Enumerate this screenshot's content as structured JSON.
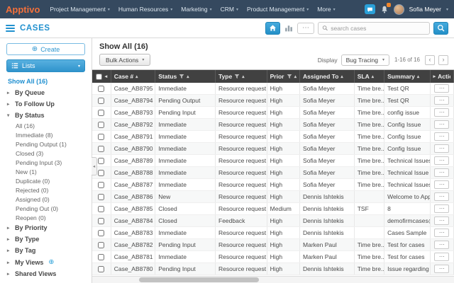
{
  "colors": {
    "topbar_bg": "#35495f",
    "logo_orange": "#f4703a",
    "accent_blue": "#2aa0d8",
    "title_blue": "#2191cf",
    "table_header_bg": "#414141"
  },
  "topbar": {
    "logo": "Apptivo",
    "menus": [
      "Project Management",
      "Human Resources",
      "Marketing",
      "CRM",
      "Product Management",
      "More"
    ],
    "user_name": "Sofia Meyer"
  },
  "appbar": {
    "title": "CASES",
    "search_placeholder": "search cases"
  },
  "sidebar": {
    "create_label": "Create",
    "lists_label": "Lists",
    "show_all_label": "Show All (16)",
    "sections": [
      {
        "label": "By Queue",
        "expanded": false,
        "items": []
      },
      {
        "label": "To Follow Up",
        "expanded": false,
        "items": []
      },
      {
        "label": "By Status",
        "expanded": true,
        "items": [
          "All  (16)",
          "Immediate  (8)",
          "Pending Output  (1)",
          "Closed  (3)",
          "Pending Input  (3)",
          "New  (1)",
          "Duplicate  (0)",
          "Rejected  (0)",
          "Assigned  (0)",
          "Pending Out  (0)",
          "Reopen  (0)"
        ]
      },
      {
        "label": "By Priority",
        "expanded": false,
        "items": []
      },
      {
        "label": "By Type",
        "expanded": false,
        "items": []
      },
      {
        "label": "By Tag",
        "expanded": false,
        "items": []
      },
      {
        "label": "My Views",
        "expanded": false,
        "items": [],
        "has_add": true
      },
      {
        "label": "Shared Views",
        "expanded": false,
        "items": []
      }
    ]
  },
  "main": {
    "heading": "Show All (16)",
    "bulk_actions_label": "Bulk Actions",
    "display_label": "Display",
    "display_value": "Bug Tracing",
    "range_text": "1-16 of 16"
  },
  "table": {
    "columns": [
      {
        "label": "Case #",
        "sort": true,
        "filter": false
      },
      {
        "label": "Status",
        "sort": true,
        "filter": true
      },
      {
        "label": "Type",
        "sort": true,
        "filter": true
      },
      {
        "label": "Priority",
        "sort": true,
        "filter": true
      },
      {
        "label": "Assigned To",
        "sort": true,
        "filter": false
      },
      {
        "label": "SLA",
        "sort": true,
        "filter": false
      },
      {
        "label": "Summary",
        "sort": true,
        "filter": false
      },
      {
        "label": "Actions",
        "sort": false,
        "filter": false,
        "scroll_chevron": true
      }
    ],
    "rows": [
      {
        "case": "Case_AB8795",
        "status": "Immediate",
        "type": "Resource request",
        "priority": "High",
        "assigned": "Sofia Meyer",
        "sla": "Time bre...",
        "summary": "Test QR"
      },
      {
        "case": "Case_AB8794",
        "status": "Pending Output",
        "type": "Resource request",
        "priority": "High",
        "assigned": "Sofia Meyer",
        "sla": "Time bre...",
        "summary": "Test QR"
      },
      {
        "case": "Case_AB8793",
        "status": "Pending Input",
        "type": "Resource request",
        "priority": "High",
        "assigned": "Sofia Meyer",
        "sla": "Time bre...",
        "summary": "config issue"
      },
      {
        "case": "Case_AB8792",
        "status": "Immediate",
        "type": "Resource request",
        "priority": "High",
        "assigned": "Sofia Meyer",
        "sla": "Time bre...",
        "summary": "Config Issue"
      },
      {
        "case": "Case_AB8791",
        "status": "Immediate",
        "type": "Resource request",
        "priority": "High",
        "assigned": "Sofia Meyer",
        "sla": "Time bre...",
        "summary": "Config Issue"
      },
      {
        "case": "Case_AB8790",
        "status": "Immediate",
        "type": "Resource request",
        "priority": "High",
        "assigned": "Sofia Meyer",
        "sla": "Time bre...",
        "summary": "Config Issue"
      },
      {
        "case": "Case_AB8789",
        "status": "Immediate",
        "type": "Resource request",
        "priority": "High",
        "assigned": "Sofia Meyer",
        "sla": "Time bre...",
        "summary": "Technical Issues"
      },
      {
        "case": "Case_AB8788",
        "status": "Immediate",
        "type": "Resource request",
        "priority": "High",
        "assigned": "Sofia Meyer",
        "sla": "Time bre...",
        "summary": "Technical Issue"
      },
      {
        "case": "Case_AB8787",
        "status": "Immediate",
        "type": "Resource request",
        "priority": "High",
        "assigned": "Sofia Meyer",
        "sla": "Time bre...",
        "summary": "Technical Issues"
      },
      {
        "case": "Case_AB8786",
        "status": "New",
        "type": "Resource request",
        "priority": "High",
        "assigned": "Dennis Ishtekis",
        "sla": "",
        "summary": "Welcome to Appti"
      },
      {
        "case": "Case_AB8785",
        "status": "Closed",
        "type": "Resource request",
        "priority": "Medium",
        "assigned": "Dennis Ishtekis",
        "sla": "TSF",
        "summary": "8"
      },
      {
        "case": "Case_AB8784",
        "status": "Closed",
        "type": "Feedback",
        "priority": "High",
        "assigned": "Dennis Ishtekis",
        "sla": "",
        "summary": "demofirmcases@"
      },
      {
        "case": "Case_AB8783",
        "status": "Immediate",
        "type": "Resource request",
        "priority": "High",
        "assigned": "Dennis Ishtekis",
        "sla": "",
        "summary": "Cases Sample"
      },
      {
        "case": "Case_AB8782",
        "status": "Pending Input",
        "type": "Resource request",
        "priority": "High",
        "assigned": "Marken Paul",
        "sla": "Time bre...",
        "summary": "Test for cases"
      },
      {
        "case": "Case_AB8781",
        "status": "Immediate",
        "type": "Resource request",
        "priority": "High",
        "assigned": "Marken Paul",
        "sla": "Time bre...",
        "summary": "Test for cases"
      },
      {
        "case": "Case_AB8780",
        "status": "Pending Input",
        "type": "Resource request",
        "priority": "High",
        "assigned": "Dennis Ishtekis",
        "sla": "Time bre...",
        "summary": "Issue regarding th"
      }
    ]
  }
}
